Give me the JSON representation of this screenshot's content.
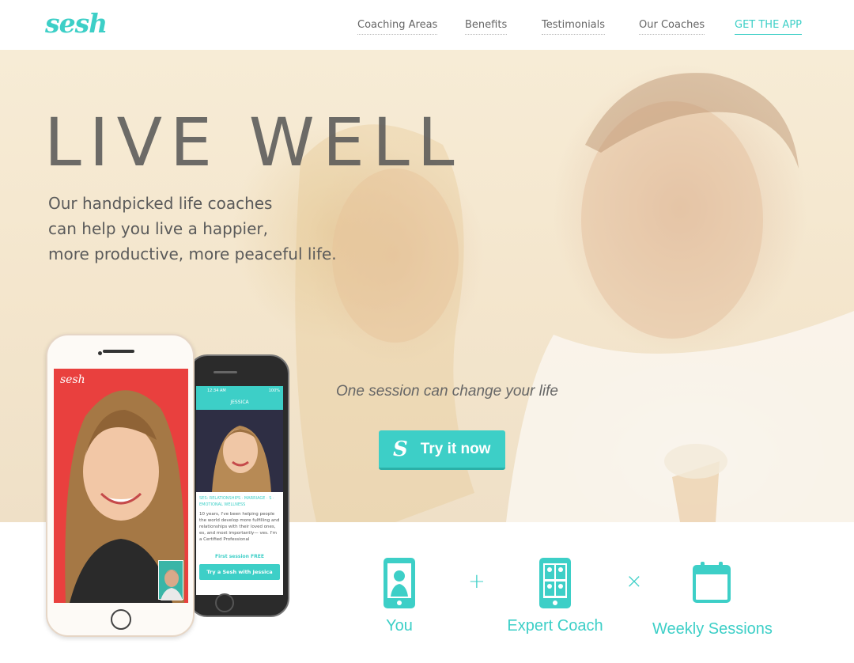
{
  "brand": {
    "logo": "sesh",
    "accent": "#3dcfc7"
  },
  "nav": {
    "links": [
      "Coaching Areas",
      "Benefits",
      "Testimonials",
      "Our Coaches"
    ],
    "cta": "GET THE APP"
  },
  "hero": {
    "headline": "LIVE WELL",
    "subcopy": [
      "Our handpicked life coaches",
      "can help you live a happier,",
      "more productive, more peaceful life."
    ],
    "tagline": "One session can change your life",
    "button_label": "Try it now"
  },
  "phones": {
    "white_screen_logo": "sesh",
    "black": {
      "status_time": "12:34 AM",
      "status_battery": "100%",
      "header": "JESSICA",
      "tags": "SES: RELATIONSHIPS · MARRIAGE · S · EMOTIONAL WELLNESS",
      "bio": "10 years, I've been helping people the world develop more fulfilling and relationships with their loved ones, es, and most importantly— ves. I'm a Certified Professional",
      "free_session": "First session FREE",
      "cta": "Try a Sesh with Jessica"
    }
  },
  "features": {
    "items": [
      {
        "label": "You",
        "icon": "phone-person-icon"
      },
      {
        "label": "Expert Coach",
        "icon": "phone-coaches-icon"
      },
      {
        "label": "Weekly Sessions",
        "icon": "calendar-icon"
      }
    ],
    "operators": [
      "+",
      "×"
    ]
  }
}
